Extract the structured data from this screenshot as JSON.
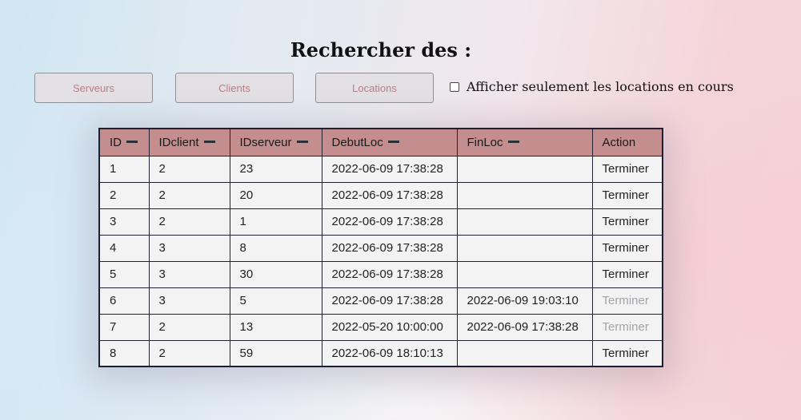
{
  "page": {
    "title": "Rechercher des :"
  },
  "buttons": {
    "serveurs": "Serveurs",
    "clients": "Clients",
    "locations": "Locations"
  },
  "filter": {
    "label": "Afficher seulement les locations en cours",
    "checked": false
  },
  "table": {
    "headers": [
      "ID",
      "IDclient",
      "IDserveur",
      "DebutLoc",
      "FinLoc",
      "Action"
    ],
    "rows": [
      {
        "id": "1",
        "idclient": "2",
        "idserveur": "23",
        "debut": "2022-06-09 17:38:28",
        "fin": "",
        "action": "Terminer",
        "action_enabled": true
      },
      {
        "id": "2",
        "idclient": "2",
        "idserveur": "20",
        "debut": "2022-06-09 17:38:28",
        "fin": "",
        "action": "Terminer",
        "action_enabled": true
      },
      {
        "id": "3",
        "idclient": "2",
        "idserveur": "1",
        "debut": "2022-06-09 17:38:28",
        "fin": "",
        "action": "Terminer",
        "action_enabled": true
      },
      {
        "id": "4",
        "idclient": "3",
        "idserveur": "8",
        "debut": "2022-06-09 17:38:28",
        "fin": "",
        "action": "Terminer",
        "action_enabled": true
      },
      {
        "id": "5",
        "idclient": "3",
        "idserveur": "30",
        "debut": "2022-06-09 17:38:28",
        "fin": "",
        "action": "Terminer",
        "action_enabled": true
      },
      {
        "id": "6",
        "idclient": "3",
        "idserveur": "5",
        "debut": "2022-06-09 17:38:28",
        "fin": "2022-06-09 19:03:10",
        "action": "Terminer",
        "action_enabled": false
      },
      {
        "id": "7",
        "idclient": "2",
        "idserveur": "13",
        "debut": "2022-05-20 10:00:00",
        "fin": "2022-06-09 17:38:28",
        "action": "Terminer",
        "action_enabled": false
      },
      {
        "id": "8",
        "idclient": "2",
        "idserveur": "59",
        "debut": "2022-06-09 18:10:13",
        "fin": "",
        "action": "Terminer",
        "action_enabled": true
      }
    ]
  },
  "colors": {
    "header_bg": "#c48e8e",
    "cell_bg": "#f3f3f4",
    "button_text": "#b57f85",
    "disabled_action": "#a3a3a8"
  }
}
